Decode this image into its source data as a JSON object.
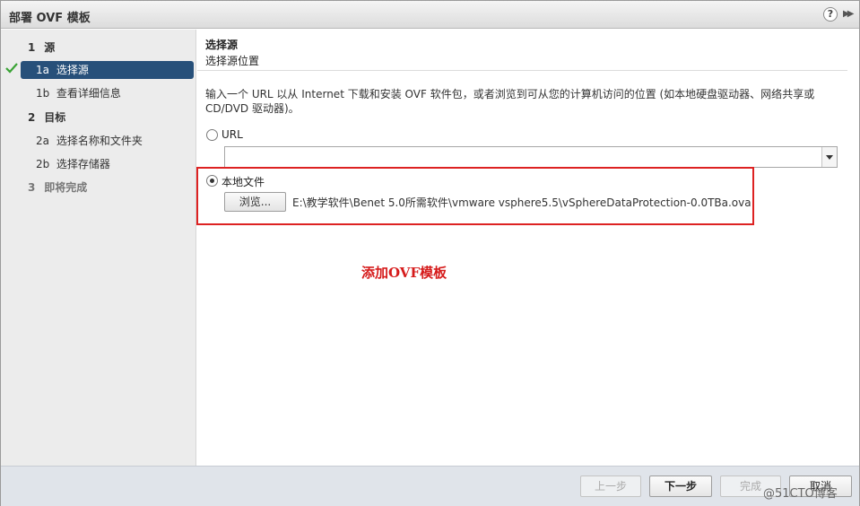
{
  "window": {
    "title": "部署 OVF 模板",
    "help_icon": "question-mark-icon",
    "help_label": "?",
    "expand_icon": "double-chevron-right-icon",
    "expand_label": "▶▶"
  },
  "nav": {
    "items": [
      {
        "num": "1",
        "label": "源",
        "group": true
      },
      {
        "num": "1a",
        "label": "选择源",
        "active": true,
        "done": true
      },
      {
        "num": "1b",
        "label": "查看详细信息"
      },
      {
        "num": "2",
        "label": "目标",
        "group": true
      },
      {
        "num": "2a",
        "label": "选择名称和文件夹"
      },
      {
        "num": "2b",
        "label": "选择存储器"
      },
      {
        "num": "3",
        "label": "即将完成",
        "disabled": true
      }
    ],
    "check_icon": "checkmark-icon"
  },
  "content": {
    "title": "选择源",
    "subtitle": "选择源位置",
    "description": "输入一个 URL 以从 Internet 下载和安装 OVF 软件包，或者浏览到可从您的计算机访问的位置 (如本地硬盘驱动器、网络共享或 CD/DVD 驱动器)。",
    "url_option_label": "URL",
    "url_value": "",
    "local_option_label": "本地文件",
    "browse_label": "浏览...",
    "file_path": "E:\\教学软件\\Benet 5.0所需软件\\vmware vsphere5.5\\vSphereDataProtection-0.0TBa.ova",
    "selected_option": "local",
    "annotation": "添加OVF模板"
  },
  "footer": {
    "back_label": "上一步",
    "next_label": "下一步",
    "finish_label": "完成",
    "cancel_label": "取消",
    "watermark": "@51CTO博客"
  },
  "colors": {
    "active_nav": "#27507a",
    "highlight_box": "#dd2222",
    "annotation": "#d61c1c",
    "checkmark": "#3aa335"
  }
}
